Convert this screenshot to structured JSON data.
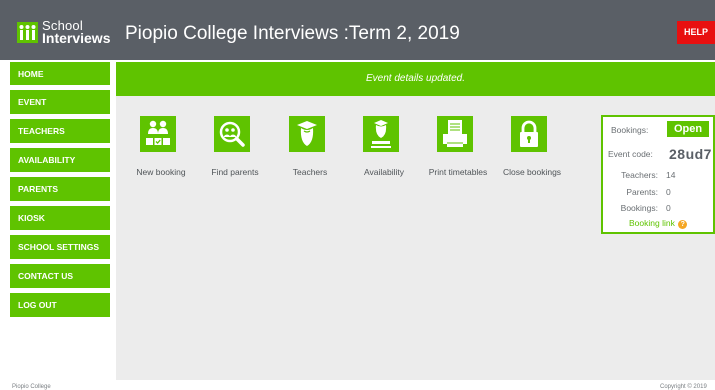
{
  "header": {
    "logo_line1": "School",
    "logo_line2": "Interviews",
    "title": "Piopio College Interviews :Term 2, 2019",
    "help_label": "HELP"
  },
  "sidebar": {
    "items": [
      {
        "label": "HOME"
      },
      {
        "label": "EVENT"
      },
      {
        "label": "TEACHERS"
      },
      {
        "label": "AVAILABILITY"
      },
      {
        "label": "PARENTS"
      },
      {
        "label": "KIOSK"
      },
      {
        "label": "SCHOOL SETTINGS"
      },
      {
        "label": "CONTACT US"
      },
      {
        "label": "LOG OUT"
      }
    ]
  },
  "main": {
    "banner": "Event details updated.",
    "tiles": [
      {
        "label": "New booking",
        "icon": "new-booking-icon"
      },
      {
        "label": "Find parents",
        "icon": "find-parents-icon"
      },
      {
        "label": "Teachers",
        "icon": "teacher-icon"
      },
      {
        "label": "Availability",
        "icon": "availability-icon"
      },
      {
        "label": "Print timetables",
        "icon": "printer-icon"
      },
      {
        "label": "Close bookings",
        "icon": "lock-icon"
      }
    ]
  },
  "status": {
    "bookings_label": "Bookings:",
    "bookings_state": "Open",
    "event_code_label": "Event code:",
    "event_code": "28ud7",
    "teachers_label": "Teachers:",
    "teachers_count": "14",
    "parents_label": "Parents:",
    "parents_count": "0",
    "bookings_count_label": "Bookings:",
    "bookings_count": "0",
    "booking_link": "Booking link",
    "help_glyph": "?"
  },
  "footer": {
    "left": "Piopio College",
    "right": "Copyright © 2019"
  },
  "colors": {
    "brand_green": "#5fc300",
    "header_gray": "#5a5f66",
    "help_red": "#e81010",
    "panel_bg": "#ececec"
  }
}
